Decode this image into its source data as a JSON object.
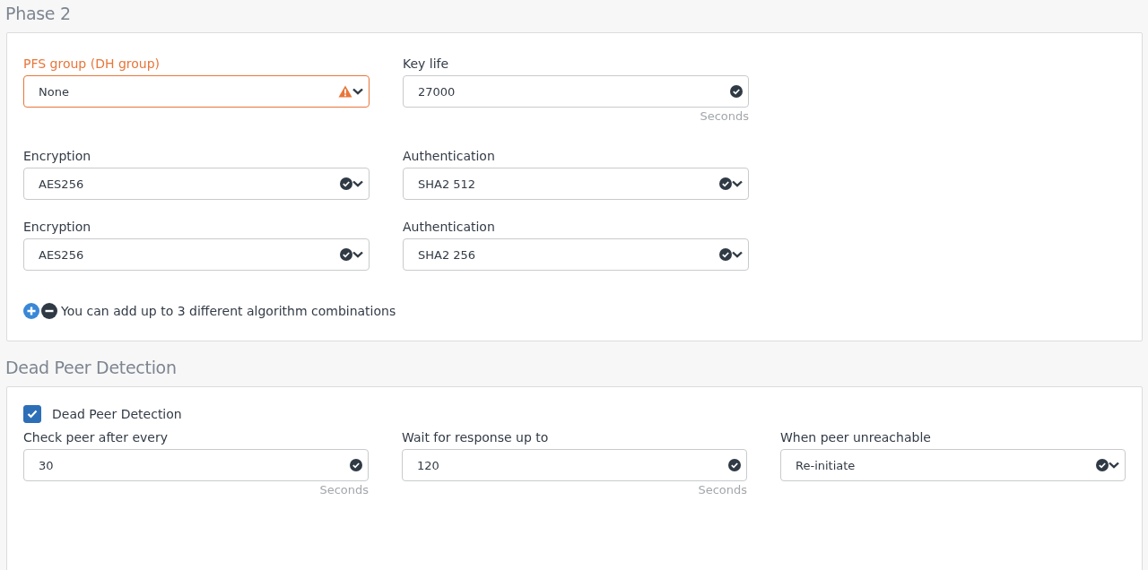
{
  "sections": [
    {
      "title": "Phase 2",
      "rows": [
        {
          "fields": [
            {
              "label": "PFS group (DH group)",
              "value": "None",
              "kind": "select",
              "warning": true
            },
            {
              "label": "Key life",
              "value": "27000",
              "kind": "text",
              "warning": false,
              "unit": "Seconds"
            }
          ]
        },
        {
          "fields": [
            {
              "label": "Encryption",
              "value": "AES256",
              "kind": "select",
              "warning": false
            },
            {
              "label": "Authentication",
              "value": "SHA2 512",
              "kind": "select",
              "warning": false
            }
          ]
        },
        {
          "fields": [
            {
              "label": "Encryption",
              "value": "AES256",
              "kind": "select",
              "warning": false
            },
            {
              "label": "Authentication",
              "value": "SHA2 256",
              "kind": "select",
              "warning": false
            }
          ]
        }
      ],
      "note": "You can add up to 3 different algorithm combinations"
    },
    {
      "title": "Dead Peer Detection",
      "checkbox": {
        "label": "Dead Peer Detection",
        "checked": true
      },
      "rows": [
        {
          "fields": [
            {
              "label": "Check peer after every",
              "value": "30",
              "kind": "text",
              "warning": false,
              "unit": "Seconds"
            },
            {
              "label": "Wait for response up to",
              "value": "120",
              "kind": "text",
              "warning": false,
              "unit": "Seconds"
            },
            {
              "label": "When peer unreachable",
              "value": "Re-initiate",
              "kind": "select",
              "warning": false
            }
          ]
        }
      ]
    }
  ]
}
